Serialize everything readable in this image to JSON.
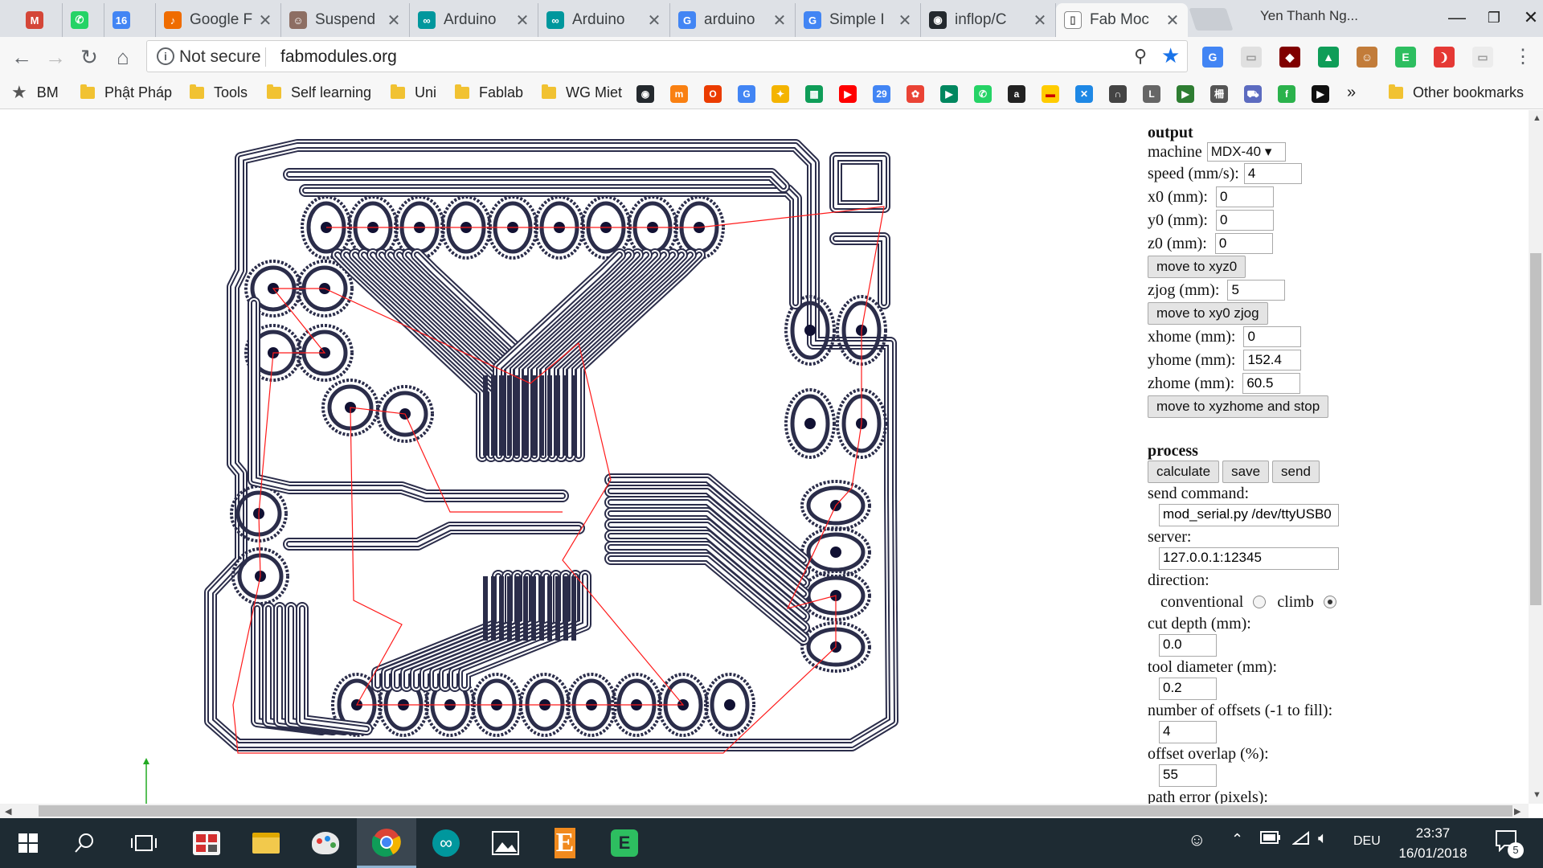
{
  "browser": {
    "tabs": [
      {
        "label": "",
        "icon": "gmail-icon",
        "color": "#d44638",
        "glyph": "M"
      },
      {
        "label": "",
        "icon": "whatsapp-icon",
        "color": "#25d366",
        "glyph": "✆"
      },
      {
        "label": "",
        "icon": "calendar-icon",
        "color": "#4285f4",
        "glyph": "16"
      },
      {
        "label": "Google F",
        "icon": "google-music-icon",
        "color": "#ef6c00",
        "glyph": "♪"
      },
      {
        "label": "Suspend",
        "icon": "suspender-icon",
        "color": "#8d6e63",
        "glyph": "☺"
      },
      {
        "label": "Arduino",
        "icon": "arduino-icon",
        "color": "#00979d",
        "glyph": "∞"
      },
      {
        "label": "Arduino",
        "icon": "arduino-icon",
        "color": "#00979d",
        "glyph": "∞"
      },
      {
        "label": "arduino",
        "icon": "google-icon",
        "color": "#4285f4",
        "glyph": "G"
      },
      {
        "label": "Simple I",
        "icon": "google-icon",
        "color": "#4285f4",
        "glyph": "G"
      },
      {
        "label": "inflop/C",
        "icon": "github-icon",
        "color": "#24292e",
        "glyph": "◉"
      },
      {
        "label": "Fab Moc",
        "icon": "page-icon",
        "color": "#ffffff",
        "glyph": "▯"
      }
    ],
    "profile_name": "Yen Thanh Ng...",
    "address": {
      "security_label": "Not secure",
      "url": "fabmodules.org"
    },
    "bookmarks": {
      "named": [
        {
          "label": "BM"
        },
        {
          "label": "Phật Pháp"
        },
        {
          "label": "Tools"
        },
        {
          "label": "Self learning"
        },
        {
          "label": "Uni"
        },
        {
          "label": "Fablab"
        },
        {
          "label": "WG Miet"
        }
      ],
      "more": "»",
      "other": "Other bookmarks"
    }
  },
  "panel": {
    "output": {
      "heading": "output",
      "machine_label": "machine",
      "machine_value": "MDX-40 ▾",
      "speed_label": "speed (mm/s):",
      "speed_value": "4",
      "x0_label": "x0 (mm):",
      "x0_value": "0",
      "y0_label": "y0 (mm):",
      "y0_value": "0",
      "z0_label": "z0 (mm):",
      "z0_value": "0",
      "move_xyz0": "move to xyz0",
      "zjog_label": "zjog (mm):",
      "zjog_value": "5",
      "move_xy0_zjog": "move to xy0 zjog",
      "xhome_label": "xhome (mm):",
      "xhome_value": "0",
      "yhome_label": "yhome (mm):",
      "yhome_value": "152.4",
      "zhome_label": "zhome (mm):",
      "zhome_value": "60.5",
      "move_home_stop": "move to xyzhome and stop"
    },
    "process": {
      "heading": "process",
      "calculate": "calculate",
      "save": "save",
      "send": "send",
      "send_command_label": "send command:",
      "send_command_value": "mod_serial.py /dev/ttyUSB0",
      "server_label": "server:",
      "server_value": "127.0.0.1:12345",
      "direction_label": "direction:",
      "conventional": "conventional",
      "climb": "climb",
      "direction_selected": "climb",
      "cut_depth_label": "cut depth (mm):",
      "cut_depth_value": "0.0",
      "tool_diameter_label": "tool diameter (mm):",
      "tool_diameter_value": "0.2",
      "offsets_label": "number of offsets (-1 to fill):",
      "offsets_value": "4",
      "overlap_label": "offset overlap (%):",
      "overlap_value": "55",
      "path_error_label": "path error (pixels):"
    }
  },
  "taskbar": {
    "language": "DEU",
    "time": "23:37",
    "date": "16/01/2018",
    "notifications": "5"
  },
  "colors": {
    "toolpath": "#2b2d4a",
    "rapid_moves": "#ff1a1a",
    "pads": "#111133"
  }
}
